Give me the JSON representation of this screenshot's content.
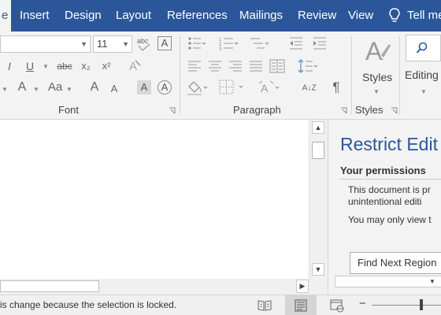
{
  "tabs": [
    "e",
    "Insert",
    "Design",
    "Layout",
    "References",
    "Mailings",
    "Review",
    "View",
    "Tell me"
  ],
  "active_tab": "e",
  "ribbon": {
    "font_size": "11",
    "font_buttons": {
      "italic": "I",
      "underline": "U",
      "strikethrough": "abc",
      "subscript": "x₂",
      "superscript": "x²",
      "font_color": "A",
      "change_case": "Aa",
      "grow_font": "A",
      "shrink_font": "A",
      "character_shading": "A",
      "character_border": "A",
      "phonetic_guide": "abc"
    },
    "paragraph_buttons": {
      "sort": "A↓Z",
      "show_marks": "¶"
    },
    "groups": {
      "font": "Font",
      "paragraph": "Paragraph",
      "styles": "Styles"
    },
    "styles_button": "Styles",
    "editing_button": "Editing"
  },
  "task_pane": {
    "title": "Restrict Edit",
    "permissions_heading": "Your permissions",
    "text_line_1": "This document is pr",
    "text_line_2": "unintentional editi",
    "text_line_3": "You may only view t",
    "find_button": "Find Next Region"
  },
  "status_bar": {
    "message": "is change because the selection is locked."
  },
  "colors": {
    "brand": "#2b579a",
    "ribbon_bg": "#f3f3f3",
    "status_bg": "#f0f0f0"
  },
  "icons": [
    "lightbulb-icon",
    "search-icon",
    "styles-icon",
    "bullets-icon",
    "numbering-icon",
    "multilevel-list-icon",
    "decrease-indent-icon",
    "increase-indent-icon",
    "align-left-icon",
    "center-icon",
    "align-right-icon",
    "justify-icon",
    "columns-icon",
    "line-spacing-icon",
    "shading-icon",
    "borders-icon",
    "text-effects-icon",
    "clear-formatting-icon",
    "dialog-launcher-icon",
    "read-mode-icon",
    "print-layout-icon",
    "web-layout-icon"
  ]
}
